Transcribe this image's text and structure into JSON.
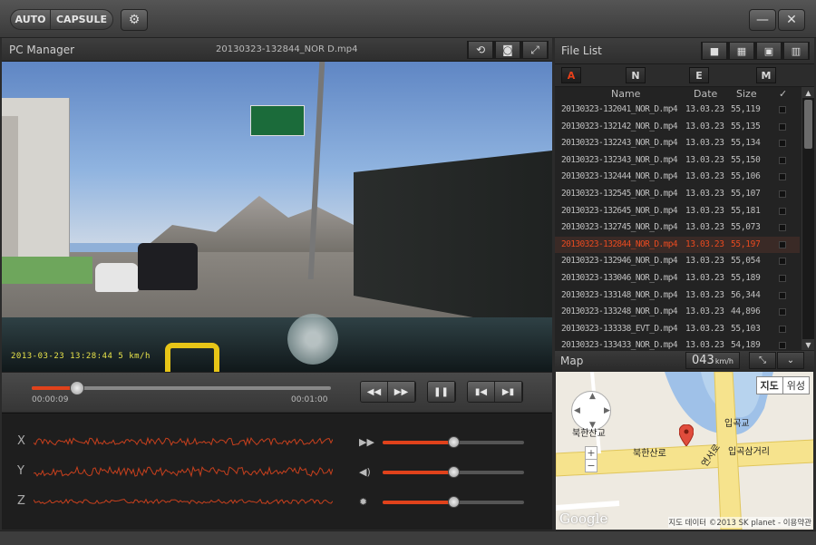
{
  "titlebar": {
    "mode_auto": "AUTO",
    "mode_capsule": "CAPSULE",
    "icons": [
      "gear-icon",
      "minimize-icon",
      "close-icon"
    ],
    "minimize_glyph": "—",
    "close_glyph": "✕"
  },
  "player": {
    "title": "PC Manager",
    "filename": "20130323-132844_NOR D.mp4",
    "toolbar_icons": [
      "repeat-icon",
      "camera-icon",
      "fullscreen-icon"
    ],
    "osd_text": "2013-03-23 13:28:44    5 km/h",
    "progress": {
      "fraction": 0.15
    },
    "elapsed": "00:00:09",
    "total": "00:01:00",
    "buttons": {
      "rewind": "◀◀",
      "forward": "▶▶",
      "pause": "❚❚",
      "prev": "▮◀",
      "next": "▶▮"
    }
  },
  "gsensor": {
    "axes": [
      "X",
      "Y",
      "Z"
    ],
    "levels": [
      {
        "icon": "speed-icon",
        "glyph": "▶▶",
        "fraction": 0.5
      },
      {
        "icon": "volume-icon",
        "glyph": "◀)",
        "fraction": 0.5
      },
      {
        "icon": "brightness-icon",
        "glyph": "✹",
        "fraction": 0.5
      }
    ],
    "accent": "#e0421b"
  },
  "filelist": {
    "title": "File List",
    "toolbar_icons": [
      "folder-icon",
      "calendar-icon",
      "save-icon",
      "trash-icon"
    ],
    "filters": [
      "A",
      "N",
      "E",
      "M"
    ],
    "selected_filter": "A",
    "columns": {
      "name": "Name",
      "date": "Date",
      "size": "Size",
      "check": "✓"
    },
    "rows": [
      {
        "name": "20130323-132041_NOR_D.mp4",
        "date": "13.03.23",
        "size": "55,119"
      },
      {
        "name": "20130323-132142_NOR_D.mp4",
        "date": "13.03.23",
        "size": "55,135"
      },
      {
        "name": "20130323-132243_NOR_D.mp4",
        "date": "13.03.23",
        "size": "55,134"
      },
      {
        "name": "20130323-132343_NOR_D.mp4",
        "date": "13.03.23",
        "size": "55,150"
      },
      {
        "name": "20130323-132444_NOR_D.mp4",
        "date": "13.03.23",
        "size": "55,106"
      },
      {
        "name": "20130323-132545_NOR_D.mp4",
        "date": "13.03.23",
        "size": "55,107"
      },
      {
        "name": "20130323-132645_NOR_D.mp4",
        "date": "13.03.23",
        "size": "55,181"
      },
      {
        "name": "20130323-132745_NOR_D.mp4",
        "date": "13.03.23",
        "size": "55,073"
      },
      {
        "name": "20130323-132844_NOR_D.mp4",
        "date": "13.03.23",
        "size": "55,197"
      },
      {
        "name": "20130323-132946_NOR_D.mp4",
        "date": "13.03.23",
        "size": "55,054"
      },
      {
        "name": "20130323-133046_NOR_D.mp4",
        "date": "13.03.23",
        "size": "55,189"
      },
      {
        "name": "20130323-133148_NOR_D.mp4",
        "date": "13.03.23",
        "size": "56,344"
      },
      {
        "name": "20130323-133248_NOR_D.mp4",
        "date": "13.03.23",
        "size": "44,896"
      },
      {
        "name": "20130323-133338_EVT_D.mp4",
        "date": "13.03.23",
        "size": "55,103"
      },
      {
        "name": "20130323-133433_NOR_D.mp4",
        "date": "13.03.23",
        "size": "54,189"
      }
    ],
    "selected_index": 8,
    "selected_color": "#e84a20"
  },
  "map": {
    "title": "Map",
    "speed_value": "043",
    "speed_unit": "km/h",
    "toggle": [
      "지도",
      "위성"
    ],
    "labels": {
      "north_bridge": "북한산교",
      "road_main": "북한산로",
      "road_yeonseo": "연서로",
      "ipgok_bridge": "입곡교",
      "ipgok_junction": "입곡삼거리"
    },
    "google": "Google",
    "copyright": "지도 데이터 ©2013 SK planet - 이용약관"
  }
}
